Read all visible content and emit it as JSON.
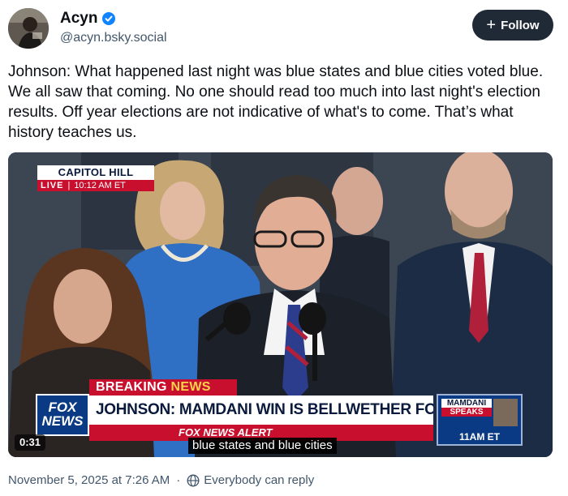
{
  "author": {
    "display_name": "Acyn",
    "handle": "@acyn.bsky.social",
    "verified": true
  },
  "follow_button": {
    "label": "Follow",
    "icon": "plus-icon"
  },
  "post": {
    "text": "Johnson: What happened last night was blue states and blue cities voted blue. We all saw that coming. No one should read too much into last night's election results. Off year elections are not indicative of what's to come. That’s what history teaches us."
  },
  "video": {
    "location": "CAPITOL HILL",
    "live_label": "LIVE",
    "live_time": "10:12 AM ET",
    "breaking_label_1": "BREAKING",
    "breaking_label_2": "NEWS",
    "network_logo": "FOX NEWS",
    "headline": "JOHNSON: MAMDANI WIN IS BELLWETHER FOR DEMS",
    "alert_strip": "FOX NEWS ALERT",
    "promo_line_1": "MAMDANI",
    "promo_line_2": "SPEAKS",
    "promo_time": "11AM ET",
    "caption": "blue states and blue cities",
    "timecode": "0:31"
  },
  "footer": {
    "timestamp": "November 5, 2025 at 7:26 AM",
    "separator": "·",
    "reply_setting": "Everybody can reply",
    "reply_icon": "globe-icon"
  },
  "colors": {
    "follow_bg": "#1f2a36",
    "verified_blue": "#1083fe",
    "fox_red": "#c8102e",
    "fox_blue": "#0b3a84",
    "muted_text": "#42576c"
  }
}
